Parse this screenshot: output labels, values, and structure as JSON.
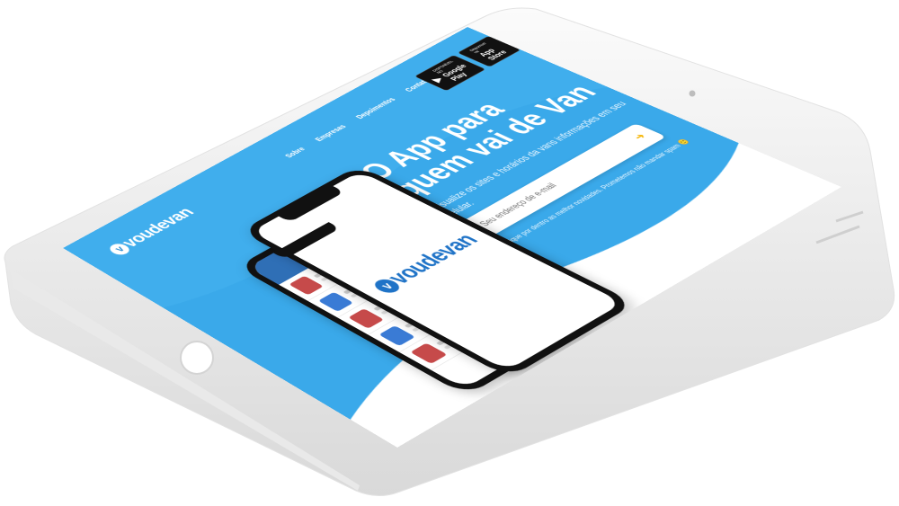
{
  "site": {
    "logo_text": "voudevan",
    "logo_mark": "v",
    "nav": [
      "Sobre",
      "Empresas",
      "Depoimentos",
      "Contato"
    ]
  },
  "stores": {
    "google": {
      "small": "DISPONÍVEL NO",
      "big": "Google Play",
      "icon": "play-icon"
    },
    "apple": {
      "small": "Disponível na",
      "big": "App Store",
      "icon": "apple-icon"
    }
  },
  "hero": {
    "title_line1": "O App para",
    "title_line2": "quem vai de Van",
    "subtitle": "Visualize os sites e horários da vans informações em seu celular.",
    "email_placeholder": "Seu endereço de e-mail",
    "notice": "*Fique por dentro as melhor novidades. Prometemos não mandar spam 🙂"
  },
  "phone": {
    "splash_logo": "voudevan",
    "splash_mark": "v"
  },
  "colors": {
    "screen_blue": "#3aa9ea",
    "wave_white": "#ffffff",
    "logo_blue": "#1f73c7",
    "accent_yellow": "#f5b400"
  }
}
